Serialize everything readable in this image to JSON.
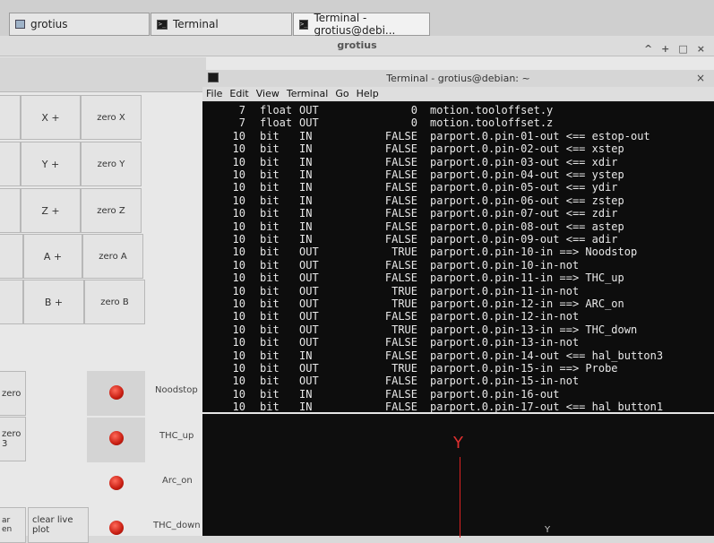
{
  "taskbar": {
    "tasks": [
      {
        "label": "grotius",
        "icon": "window-icon"
      },
      {
        "label": "Terminal",
        "icon": "terminal-icon"
      },
      {
        "label": "Terminal - grotius@debi...",
        "icon": "terminal-icon"
      }
    ]
  },
  "back_window": {
    "title": "grotius",
    "controls": [
      "^",
      "+",
      "□",
      "×"
    ],
    "jog_rows": [
      {
        "axis": "X +",
        "zero": "zero X"
      },
      {
        "axis": "Y +",
        "zero": "zero Y"
      },
      {
        "axis": "Z +",
        "zero": "zero Z"
      },
      {
        "axis": "A +",
        "zero": "zero A"
      },
      {
        "axis": "B +",
        "zero": "zero B"
      }
    ],
    "left_buttons": [
      "zero",
      "zero\n3",
      "ar\nen",
      "clear live\nplot"
    ],
    "leds": [
      {
        "label": "Noodstop",
        "color": "#d0251a"
      },
      {
        "label": "THC_up",
        "color": "#d0251a"
      },
      {
        "label": "Arc_on",
        "color": "#d0251a"
      },
      {
        "label": "THC_down",
        "color": "#d0251a"
      }
    ]
  },
  "terminal": {
    "title": "Terminal - grotius@debian: ~",
    "close": "×",
    "menu": [
      "File",
      "Edit",
      "View",
      "Terminal",
      "Go",
      "Help"
    ],
    "rows": [
      {
        "owner": "7",
        "type": "float",
        "dir": "OUT",
        "value": "0",
        "name": "motion.tooloffset.y"
      },
      {
        "owner": "7",
        "type": "float",
        "dir": "OUT",
        "value": "0",
        "name": "motion.tooloffset.z"
      },
      {
        "owner": "10",
        "type": "bit",
        "dir": "IN",
        "value": "FALSE",
        "name": "parport.0.pin-01-out <== estop-out"
      },
      {
        "owner": "10",
        "type": "bit",
        "dir": "IN",
        "value": "FALSE",
        "name": "parport.0.pin-02-out <== xstep"
      },
      {
        "owner": "10",
        "type": "bit",
        "dir": "IN",
        "value": "FALSE",
        "name": "parport.0.pin-03-out <== xdir"
      },
      {
        "owner": "10",
        "type": "bit",
        "dir": "IN",
        "value": "FALSE",
        "name": "parport.0.pin-04-out <== ystep"
      },
      {
        "owner": "10",
        "type": "bit",
        "dir": "IN",
        "value": "FALSE",
        "name": "parport.0.pin-05-out <== ydir"
      },
      {
        "owner": "10",
        "type": "bit",
        "dir": "IN",
        "value": "FALSE",
        "name": "parport.0.pin-06-out <== zstep"
      },
      {
        "owner": "10",
        "type": "bit",
        "dir": "IN",
        "value": "FALSE",
        "name": "parport.0.pin-07-out <== zdir"
      },
      {
        "owner": "10",
        "type": "bit",
        "dir": "IN",
        "value": "FALSE",
        "name": "parport.0.pin-08-out <== astep"
      },
      {
        "owner": "10",
        "type": "bit",
        "dir": "IN",
        "value": "FALSE",
        "name": "parport.0.pin-09-out <== adir"
      },
      {
        "owner": "10",
        "type": "bit",
        "dir": "OUT",
        "value": "TRUE",
        "name": "parport.0.pin-10-in ==> Noodstop"
      },
      {
        "owner": "10",
        "type": "bit",
        "dir": "OUT",
        "value": "FALSE",
        "name": "parport.0.pin-10-in-not"
      },
      {
        "owner": "10",
        "type": "bit",
        "dir": "OUT",
        "value": "FALSE",
        "name": "parport.0.pin-11-in ==> THC_up"
      },
      {
        "owner": "10",
        "type": "bit",
        "dir": "OUT",
        "value": "TRUE",
        "name": "parport.0.pin-11-in-not"
      },
      {
        "owner": "10",
        "type": "bit",
        "dir": "OUT",
        "value": "TRUE",
        "name": "parport.0.pin-12-in ==> ARC_on"
      },
      {
        "owner": "10",
        "type": "bit",
        "dir": "OUT",
        "value": "FALSE",
        "name": "parport.0.pin-12-in-not"
      },
      {
        "owner": "10",
        "type": "bit",
        "dir": "OUT",
        "value": "TRUE",
        "name": "parport.0.pin-13-in ==> THC_down"
      },
      {
        "owner": "10",
        "type": "bit",
        "dir": "OUT",
        "value": "FALSE",
        "name": "parport.0.pin-13-in-not"
      },
      {
        "owner": "10",
        "type": "bit",
        "dir": "IN",
        "value": "FALSE",
        "name": "parport.0.pin-14-out <== hal_button3"
      },
      {
        "owner": "10",
        "type": "bit",
        "dir": "OUT",
        "value": "TRUE",
        "name": "parport.0.pin-15-in ==> Probe"
      },
      {
        "owner": "10",
        "type": "bit",
        "dir": "OUT",
        "value": "FALSE",
        "name": "parport.0.pin-15-in-not"
      },
      {
        "owner": "10",
        "type": "bit",
        "dir": "IN",
        "value": "FALSE",
        "name": "parport.0.pin-16-out"
      },
      {
        "owner": "10",
        "type": "bit",
        "dir": "IN",
        "value": "FALSE",
        "name": "parport.0.pin-17-out <== hal_button1"
      }
    ],
    "preview": {
      "axis_label": "Y",
      "lower_label": "Y",
      "axis_color": "#d22222"
    }
  }
}
